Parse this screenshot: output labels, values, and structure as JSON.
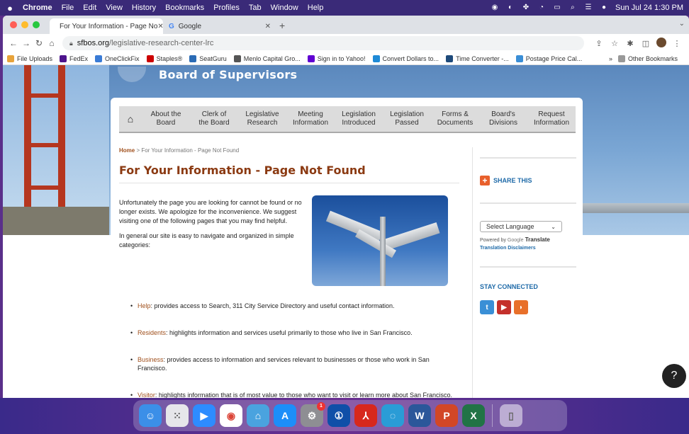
{
  "menubar": {
    "items": [
      "Chrome",
      "File",
      "Edit",
      "View",
      "History",
      "Bookmarks",
      "Profiles",
      "Tab",
      "Window",
      "Help"
    ],
    "datetime": "Sun Jul 24  1:30 PM"
  },
  "browser": {
    "active_tab": "For Your Information - Page No",
    "inactive_tab": "Google",
    "url_domain": "sfbos.org",
    "url_path": "/legislative-research-center-lrc",
    "bookmarks": [
      "File Uploads",
      "FedEx",
      "OneClickFix",
      "Staples®",
      "SeatGuru",
      "Menlo Capital Gro...",
      "Sign in to Yahoo!",
      "Convert Dollars to...",
      "Time Converter -...",
      "Postage Price Cal..."
    ],
    "bookmarks_more": "»",
    "other_bookmarks": "Other Bookmarks"
  },
  "site": {
    "title": "Board of Supervisors",
    "nav": [
      "About the\nBoard",
      "Clerk of\nthe Board",
      "Legislative\nResearch",
      "Meeting\nInformation",
      "Legislation\nIntroduced",
      "Legislation\nPassed",
      "Forms &\nDocuments",
      "Board's\nDivisions",
      "Request\nInformation"
    ]
  },
  "page": {
    "breadcrumb_home": "Home",
    "breadcrumb_rest": " > For Your Information - Page Not Found",
    "title": "For Your Information - Page Not Found",
    "para1": "Unfortunately the page you are looking for cannot be found or no longer exists. We apologize for the inconvenience. We suggest visiting one of the following pages that you may find helpful.",
    "para2": "In general our site is easy to navigate and organized in simple categories:",
    "list": [
      {
        "link": "Help",
        "text": ": provides access to Search, 311 City Service Directory and useful contact information."
      },
      {
        "link": "Residents",
        "text": ": highlights information and services useful primarily to those who live in San Francisco."
      },
      {
        "link": "Business",
        "text": ": provides access to information and services relevant to businesses or those who work in San Francisco."
      },
      {
        "link": "Visitor",
        "text": ": highlights information that is of most value to those who want to visit or learn more about San Francisco."
      }
    ]
  },
  "sidebar": {
    "share": "SHARE THIS",
    "language": "Select Language",
    "powered_by": "Powered by ",
    "google": "Google",
    "translate": " Translate",
    "disclaimers": "Translation Disclaimers",
    "stay_connected": "STAY CONNECTED"
  },
  "dock": {
    "badge": "1"
  }
}
